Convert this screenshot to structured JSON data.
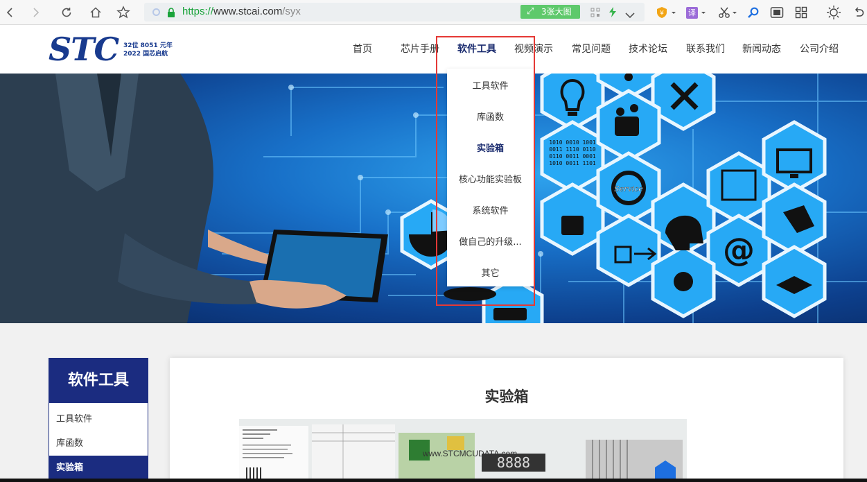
{
  "browser": {
    "url_scheme": "https://",
    "url_host": "www.stcai.com",
    "url_path": "/syx",
    "big_image_label": "3张大图",
    "translate_label": "译"
  },
  "site": {
    "logo_text": "STC",
    "logo_slogan_line1": "32位 8051 元年",
    "logo_slogan_line2": "2022 国芯启航",
    "nav": [
      {
        "label": "首页"
      },
      {
        "label": "芯片手册"
      },
      {
        "label": "软件工具"
      },
      {
        "label": "视频演示"
      },
      {
        "label": "常见问题"
      },
      {
        "label": "技术论坛"
      },
      {
        "label": "联系我们"
      },
      {
        "label": "新闻动态"
      },
      {
        "label": "公司介绍"
      }
    ],
    "active_nav": "软件工具"
  },
  "dropdown": {
    "items": [
      {
        "label": "工具软件"
      },
      {
        "label": "库函数"
      },
      {
        "label": "实验箱"
      },
      {
        "label": "核心功能实验板"
      },
      {
        "label": "系统软件"
      },
      {
        "label": "做自己的升级..."
      },
      {
        "label": "其它"
      }
    ],
    "active_item": "实验箱"
  },
  "banner": {
    "binary_text": [
      "1010 0010 1001",
      "0011 1110 0110",
      "0110 0011 0001",
      "1010 0011 1101"
    ],
    "service_text": "Service",
    "at_text": "@"
  },
  "sidebar": {
    "title": "软件工具",
    "items": [
      {
        "label": "工具软件"
      },
      {
        "label": "库函数"
      },
      {
        "label": "实验箱"
      }
    ]
  },
  "main": {
    "title": "实验箱",
    "photo_brand": "www.STCMCUDATA.com",
    "photo_display": "8888"
  },
  "colors": {
    "brand_blue": "#1b2c80",
    "highlight_red": "#e53935",
    "https_green": "#1aa33b"
  }
}
